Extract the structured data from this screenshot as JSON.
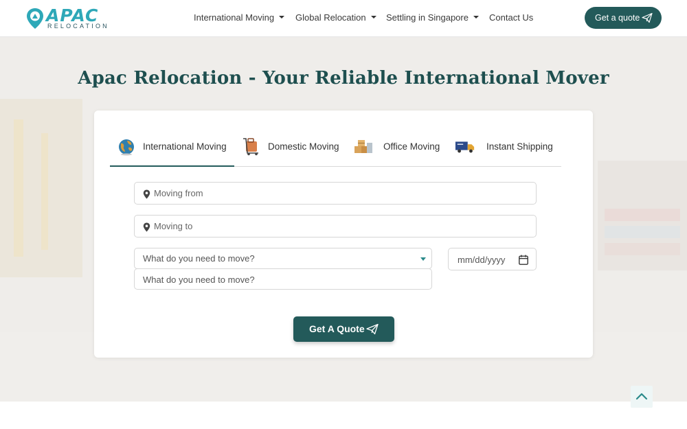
{
  "header": {
    "logo": {
      "name": "APAC",
      "sub": "RELOCATION"
    },
    "nav": [
      {
        "label": "International Moving",
        "dropdown": true
      },
      {
        "label": "Global Relocation",
        "dropdown": true
      },
      {
        "label": "Settling in Singapore",
        "dropdown": true
      },
      {
        "label": "Contact Us",
        "dropdown": false
      }
    ],
    "cta_label": "Get a quote",
    "cta_icon": "paper-plane-icon"
  },
  "hero": {
    "title": "Apac Relocation - Your Reliable International Mover"
  },
  "quote_form": {
    "tabs": [
      {
        "label": "International Moving",
        "icon": "globe-icon",
        "active": true
      },
      {
        "label": "Domestic Moving",
        "icon": "luggage-cart-icon",
        "active": false
      },
      {
        "label": "Office Moving",
        "icon": "boxes-icon",
        "active": false
      },
      {
        "label": "Instant Shipping",
        "icon": "fast-truck-icon",
        "active": false
      }
    ],
    "moving_from_placeholder": "Moving from",
    "moving_to_placeholder": "Moving to",
    "what_select_value": "What do you need to move?",
    "what_input_placeholder": "What do you need to move?",
    "date_placeholder": "mm/dd/yyyy",
    "submit_label": "Get A Quote"
  },
  "colors": {
    "brand_dark": "#235a5a",
    "brand_teal": "#2ea8b8",
    "title": "#1e4f4f"
  }
}
